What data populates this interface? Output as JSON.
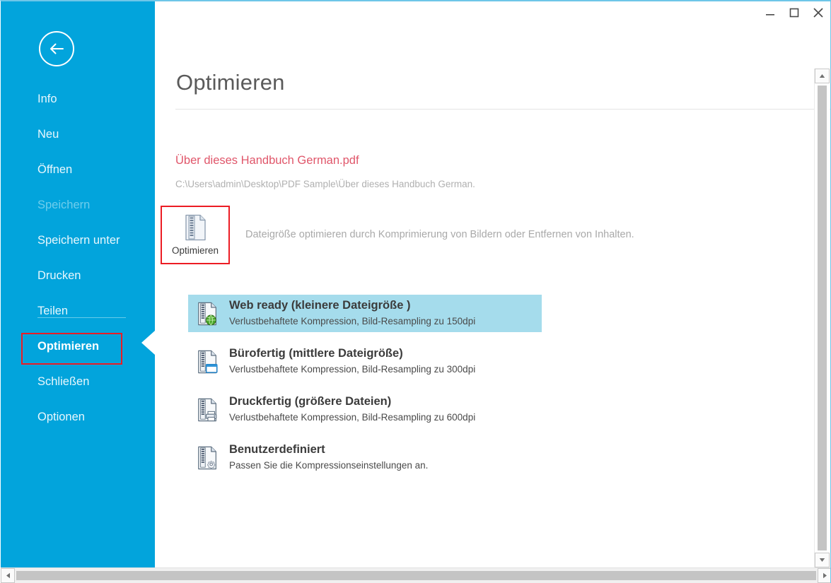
{
  "window": {
    "controls": [
      {
        "name": "minimize",
        "icon": "minimize-icon",
        "tooltip": "Minimieren"
      },
      {
        "name": "maximize",
        "icon": "maximize-icon",
        "tooltip": "Maximieren"
      },
      {
        "name": "close",
        "icon": "close-icon",
        "tooltip": "Schließen"
      }
    ],
    "accent_color": "#02a4dc",
    "highlight_color": "#ec1c24"
  },
  "sidebar": {
    "back_button": {
      "icon": "back-arrow-icon",
      "label": ""
    },
    "items": [
      {
        "label": "Info",
        "state": "normal"
      },
      {
        "label": "Neu",
        "state": "normal"
      },
      {
        "label": "Öffnen",
        "state": "normal"
      },
      {
        "label": "Speichern",
        "state": "disabled"
      },
      {
        "label": "Speichern unter",
        "state": "normal"
      },
      {
        "label": "Drucken",
        "state": "normal"
      },
      {
        "label": "Teilen",
        "state": "normal"
      },
      {
        "label": "Optimieren",
        "state": "active"
      },
      {
        "label": "Schließen",
        "state": "normal"
      },
      {
        "label": "Optionen",
        "state": "normal"
      }
    ]
  },
  "main": {
    "title": "Optimieren",
    "file_name": "Über dieses Handbuch  German.pdf",
    "file_path": "C:\\Users\\admin\\Desktop\\PDF Sample\\Über dieses Handbuch  German.",
    "action_button": {
      "label": "Optimieren",
      "icon": "compressed-document-icon"
    },
    "action_description": "Dateigröße optimieren durch Komprimierung von Bildern oder Entfernen von Inhalten.",
    "presets": [
      {
        "title": "Web ready (kleinere Dateigröße )",
        "description": "Verlustbehaftete Kompression, Bild-Resampling zu 150dpi",
        "icon": "document-globe-icon",
        "selected": true
      },
      {
        "title": "Bürofertig (mittlere Dateigröße)",
        "description": "Verlustbehaftete Kompression, Bild-Resampling zu 300dpi",
        "icon": "document-monitor-icon",
        "selected": false
      },
      {
        "title": "Druckfertig (größere Dateien)",
        "description": "Verlustbehaftete Kompression, Bild-Resampling zu 600dpi",
        "icon": "document-printer-icon",
        "selected": false
      },
      {
        "title": "Benutzerdefiniert",
        "description": "Passen Sie die Kompressionseinstellungen an.",
        "icon": "document-gear-icon",
        "selected": false
      }
    ]
  },
  "scrollbars": {
    "vertical": {
      "up_icon": "scroll-up-icon",
      "down_icon": "scroll-down-icon"
    },
    "horizontal": {
      "left_icon": "scroll-left-icon",
      "right_icon": "scroll-right-icon"
    }
  }
}
